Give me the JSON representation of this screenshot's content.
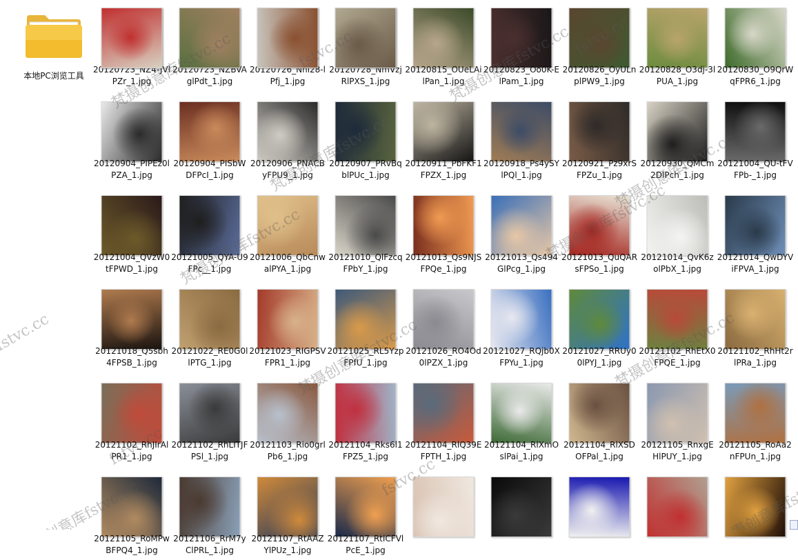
{
  "folder": {
    "label": "本地PC浏览工具",
    "icon": "folder-icon"
  },
  "files": [
    "20120723_NZ4-JVlPZr_1.jpg",
    "20120723_NZBVAglPdt_1.jpg",
    "20120726_Nhl28-lPfj_1.jpg",
    "20120728_NmVzjRlPXS_1.jpg",
    "20120815_OUeLAilPan_1.jpg",
    "20120823_Oo0K-ElPam_1.jpg",
    "20120826_OyULnplPW9_1.jpg",
    "20120828_O3dj-3lPUA_1.jpg",
    "20120830_O9QrWqFPR6_1.jpg",
    "20120904_PIPEz0lPZA_1.jpg",
    "20120904_PISbWDFPcI_1.jpg",
    "20120906_PNACByFPU9_1.jpg",
    "20120907_PRvBqblPUc_1.jpg",
    "20120911_PbFKF1FPZX_1.jpg",
    "20120918_Ps4ySYlPQl_1.jpg",
    "20120921_Pz9xrSFPZu_1.jpg",
    "20120930_QMCm2DlPch_1.jpg",
    "20121004_QU-tFVFPb-_1.jpg",
    "20121004_QVzW0tFPWD_1.jpg",
    "20121005_QYA-U9FPc__1.jpg",
    "20121006_QbCnwalPYA_1.jpg",
    "20121010_QlFzcqFPbY_1.jpg",
    "20121013_Qs9NJSFPQe_1.jpg",
    "20121013_Qs494GlPcg_1.jpg",
    "20121013_QuQARsFPSo_1.jpg",
    "20121014_QvK6zolPbX_1.jpg",
    "20121014_QwDYViFPVA_1.jpg",
    "20121018_Q5sbh4FPSB_1.jpg",
    "20121022_RE0G0llPTG_1.jpg",
    "20121023_RIGPSVFPR1_1.jpg",
    "20121025_RL5YzpFPfU_1.jpg",
    "20121026_RO4Od0lPZX_1.jpg",
    "20121027_RQjb0XFPYu_1.jpg",
    "20121027_RRUy00lPYJ_1.jpg",
    "20121102_RhEtX0FPQE_1.jpg",
    "20121102_RhHt2rlPRa_1.jpg",
    "20121102_RhJIrAlPR1_1.jpg",
    "20121102_RhLITJFPSl_1.jpg",
    "20121103_Rio0grlPb6_1.jpg",
    "20121104_Rks6l1FPZ5_1.jpg",
    "20121104_RlQ39EFPTH_1.jpg",
    "20121104_RlXmOslPai_1.jpg",
    "20121104_RlXSDOFPal_1.jpg",
    "20121105_RnxgEHlPUY_1.jpg",
    "20121105_RoAa2nFPUn_1.jpg",
    "20121105_RoMPwBFPQ4_1.jpg",
    "20121106_RrM7yClPRL_1.jpg",
    "20121107_RtAAZYlPUz_1.jpg",
    "20121107_RtICFVlPcE_1.jpg",
    "",
    "",
    "",
    "",
    "",
    "",
    "",
    "",
    ""
  ],
  "thumb_colors": [
    [
      "#1d2a44",
      "#d07a2c"
    ],
    [
      "#3d6b2e",
      "#d8b7a5"
    ],
    [
      "#8a8f9a",
      "#2c2c2c"
    ],
    [
      "#d6c9a8",
      "#7a1c1c"
    ],
    [
      "#3c4a2a",
      "#b7a68a"
    ],
    [
      "#1a1718",
      "#4b2f2f"
    ],
    [
      "#3f5a30",
      "#5a4630"
    ],
    [
      "#6d8c3e",
      "#b9a46c"
    ],
    [
      "#3e6b2b",
      "#d7d7c8"
    ],
    [
      "#e8e8e8",
      "#2a2a2a"
    ],
    [
      "#6b2f22",
      "#c98b5b"
    ],
    [
      "#2b2b2b",
      "#d0ccc4"
    ],
    [
      "#59633e",
      "#1e2a3a"
    ],
    [
      "#151515",
      "#bdb4a0"
    ],
    [
      "#a07c55",
      "#3d4c66"
    ],
    [
      "#7a5c47",
      "#2e2a28"
    ],
    [
      "#d8d2c4",
      "#1e1e1e"
    ],
    [
      "#0f0f0f",
      "#6a6a6a"
    ],
    [
      "#2a1a1a",
      "#6d5a2a"
    ],
    [
      "#5a6c9a",
      "#1e1e1e"
    ],
    [
      "#b88a5a",
      "#e0c08a"
    ],
    [
      "#d9d4c8",
      "#4a4a4a"
    ],
    [
      "#7a2f1e",
      "#f09a52"
    ],
    [
      "#3a6fb8",
      "#e7c7a6"
    ],
    [
      "#e9e4d6",
      "#a3241e"
    ],
    [
      "#bdbdb8",
      "#f4f4f2"
    ],
    [
      "#6f8fb8",
      "#2a3a4a"
    ],
    [
      "#1b1410",
      "#b07b4e"
    ],
    [
      "#c0a070",
      "#8a6a40"
    ],
    [
      "#a43a2a",
      "#d8b28a"
    ],
    [
      "#3e5a7a",
      "#d99a4a"
    ],
    [
      "#c8c8cc",
      "#8a8a90"
    ],
    [
      "#3a70c0",
      "#e8e8f0"
    ],
    [
      "#2f72c8",
      "#5f8a3a"
    ],
    [
      "#6f8040",
      "#b84a3a"
    ],
    [
      "#8a6a40",
      "#d8b070"
    ],
    [
      "#7a6f58",
      "#c04a3a"
    ],
    [
      "#8a8f98",
      "#3a3a3a"
    ],
    [
      "#8a5a40",
      "#b8c0cc"
    ],
    [
      "#a0b4c8",
      "#c03040"
    ],
    [
      "#c85a3a",
      "#5a6a7a"
    ],
    [
      "#3e6a36",
      "#eaeaea"
    ],
    [
      "#d0b890",
      "#6a5040"
    ],
    [
      "#8a98b0",
      "#d0c0b0"
    ],
    [
      "#7a9ab8",
      "#b07040"
    ],
    [
      "#1e2a3a",
      "#b08a60"
    ],
    [
      "#8aa0b8",
      "#4a3a30"
    ],
    [
      "#2a3a5a",
      "#d08a3a"
    ],
    [
      "#1a2a4a",
      "#f0a050"
    ],
    [
      "#d8c0b0",
      "#f0e8e0"
    ],
    [
      "#0a0a0a",
      "#3a3a3a"
    ],
    [
      "#1818b0",
      "#f0f0f0"
    ],
    [
      "#b0a090",
      "#c03030"
    ],
    [
      "#201008",
      "#e0a040"
    ],
    [
      "#d8d0c0",
      "#c03030"
    ],
    [
      "#5a7040",
      "#a08060"
    ],
    [
      "#c8c4bc",
      "#8a5030"
    ],
    [
      "#b0a890",
      "#6a5a48"
    ]
  ],
  "watermark": {
    "texts": [
      "梵摄创意库fstvc.cc",
      "fstvc.cc"
    ]
  }
}
